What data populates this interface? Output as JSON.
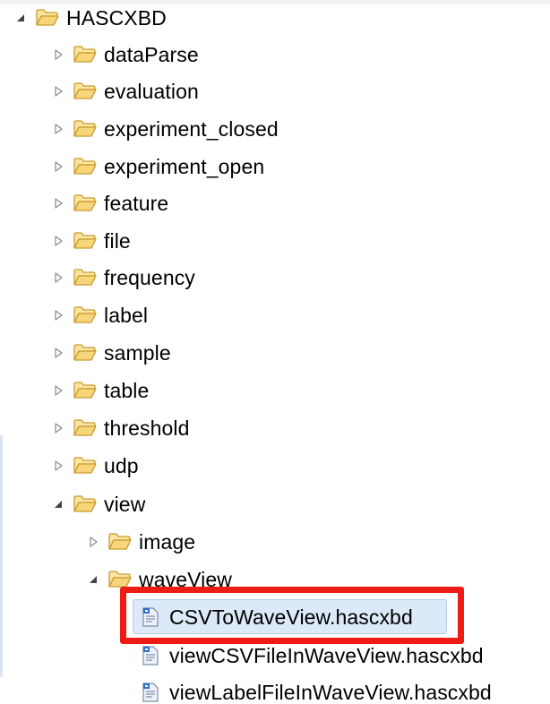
{
  "tree": {
    "root": {
      "label": "HASCXBD",
      "expanded": true
    },
    "children": [
      {
        "label": "dataParse",
        "expanded": false
      },
      {
        "label": "evaluation",
        "expanded": false
      },
      {
        "label": "experiment_closed",
        "expanded": false
      },
      {
        "label": "experiment_open",
        "expanded": false
      },
      {
        "label": "feature",
        "expanded": false
      },
      {
        "label": "file",
        "expanded": false
      },
      {
        "label": "frequency",
        "expanded": false
      },
      {
        "label": "label",
        "expanded": false
      },
      {
        "label": "sample",
        "expanded": false
      },
      {
        "label": "table",
        "expanded": false
      },
      {
        "label": "threshold",
        "expanded": false
      },
      {
        "label": "udp",
        "expanded": false
      },
      {
        "label": "view",
        "expanded": true
      }
    ],
    "view_children": [
      {
        "label": "image",
        "expanded": false
      },
      {
        "label": "waveView",
        "expanded": true
      }
    ],
    "waveView_files": [
      {
        "label": "CSVToWaveView.hascxbd",
        "selected": true
      },
      {
        "label": "viewCSVFileInWaveView.hascxbd",
        "selected": false
      },
      {
        "label": "viewLabelFileInWaveView.hascxbd",
        "selected": false
      }
    ]
  },
  "icons": {
    "expanded_twisty": "expanded-triangle-icon",
    "collapsed_twisty": "collapsed-triangle-icon",
    "folder": "folder-open-icon",
    "file": "hascxbd-file-icon"
  },
  "colors": {
    "highlight_frame": "#ee1c14",
    "selection_fill": "#dbe9f8",
    "folder_fill": "#f7d57a",
    "folder_stroke": "#c99a2e"
  }
}
